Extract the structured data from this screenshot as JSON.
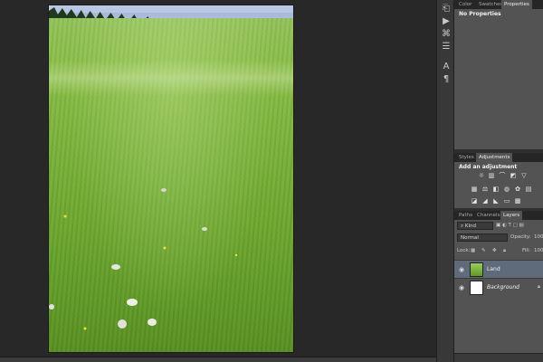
{
  "panels": {
    "top_tabs": [
      "Color",
      "Swatches",
      "Properties"
    ],
    "properties_text": "No Properties",
    "mid_tabs": [
      "Styles",
      "Adjustments"
    ],
    "adjustments_title": "Add an adjustment",
    "layers_tabs": [
      "Paths",
      "Channels",
      "Layers"
    ],
    "kind_label": "Kind",
    "blend_mode": "Normal",
    "opacity_label": "Opacity:",
    "opacity_value": "100",
    "lock_label": "Lock:",
    "fill_label": "Fill:",
    "fill_value": "100",
    "layers": [
      {
        "name": "Land",
        "selected": true
      },
      {
        "name": "Background",
        "selected": false
      }
    ]
  },
  "status": {
    "zoom": ""
  },
  "colors": {
    "panel": "#535353",
    "selection": "#5f6a7a",
    "workspace": "#282828"
  }
}
